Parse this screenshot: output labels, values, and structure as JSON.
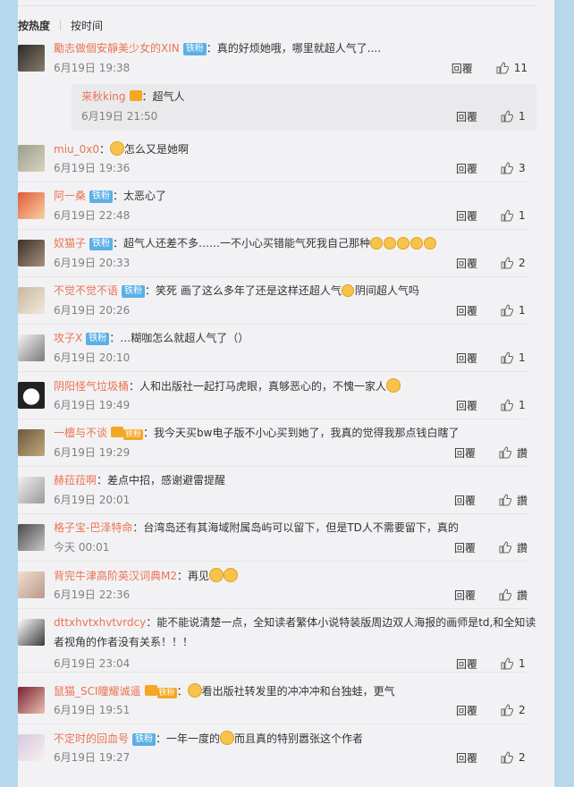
{
  "sort": {
    "hot": "按热度",
    "time": "按时间"
  },
  "labels": {
    "reply": "回覆",
    "like_icon": "thumbs-up-icon"
  },
  "colors": {
    "name": "#eb7350",
    "badge": "#5bb0e6",
    "background": "#b6d7ec"
  },
  "comments": [
    {
      "name": "勵志做個安靜美少女的XIN",
      "badge": "铁粉",
      "text": "：真的好烦她哦，哪里就超人气了....",
      "time": "6月19日 19:38",
      "likes": "11"
    },
    {
      "name": "miu_0x0",
      "badge": "",
      "text": "怎么又是她啊",
      "time": "6月19日 19:36",
      "likes": "3"
    },
    {
      "name": "阿一桑",
      "badge": "铁粉",
      "text": "：太恶心了",
      "time": "6月19日 22:48",
      "likes": "1"
    },
    {
      "name": "奴猫子",
      "badge": "铁粉",
      "text": "：超气人还差不多……一不小心买错能气死我自己那种",
      "time": "6月19日 20:33",
      "likes": "2"
    },
    {
      "name": "不觉不觉不语",
      "badge": "铁粉",
      "text": "：笑死 画了这么多年了还是这样还超人气",
      "text2": "阴间超人气吗",
      "time": "6月19日 20:26",
      "likes": "1"
    },
    {
      "name": "攻子X",
      "badge": "铁粉",
      "text": "：…糊咖怎么就超人气了（）",
      "time": "6月19日 20:10",
      "likes": "1"
    },
    {
      "name": "阴阳怪气垃圾桶",
      "badge": "",
      "text": "：人和出版社一起打马虎眼，真够恶心的，不愧一家人",
      "time": "6月19日 19:49",
      "likes": "1"
    },
    {
      "name": "一檀与不谈",
      "badge": "铁粉",
      "text": "：我今天买bw电子版不小心买到她了，我真的觉得我那点钱白瞎了",
      "time": "6月19日 19:29",
      "likes": "讚"
    },
    {
      "name": "赫菈菈啊",
      "badge": "",
      "text": "：差点中招，感谢避雷提醒",
      "time": "6月19日 20:01",
      "likes": "讚"
    },
    {
      "name": "格子宝-巴泽特命",
      "badge": "",
      "text": "：台湾岛还有其海域附属岛屿可以留下，但是TD人不需要留下，真的",
      "time": "今天 00:01",
      "likes": "讚"
    },
    {
      "name": "背完牛津高阶英汉词典M2",
      "badge": "",
      "text": "：再见",
      "time": "6月19日 22:36",
      "likes": "讚"
    },
    {
      "name": "dttxhvtxhvtvrdcy",
      "badge": "",
      "text": "：能不能说清楚一点，全知读者繁体小说特装版周边双人海报的画师是td,和全知读",
      "text2": "者视角的作者没有关系！！！",
      "time": "6月19日 23:04",
      "likes": "1"
    },
    {
      "name": "鼠猫_SCI瞳耀诚遥",
      "badge": "铁粉",
      "text": "看出版社转发里的冲冲冲和台独蛙，更气",
      "time": "6月19日 19:51",
      "likes": "2"
    },
    {
      "name": "不定时的回血号",
      "badge": "铁粉",
      "text": "：一年一度的",
      "text2": "而且真的特别嚣张这个作者",
      "time": "6月19日 19:27",
      "likes": "2"
    }
  ],
  "reply": {
    "name": "来秋king",
    "text": "：超气人",
    "time": "6月19日 21:50",
    "likes": "1"
  }
}
